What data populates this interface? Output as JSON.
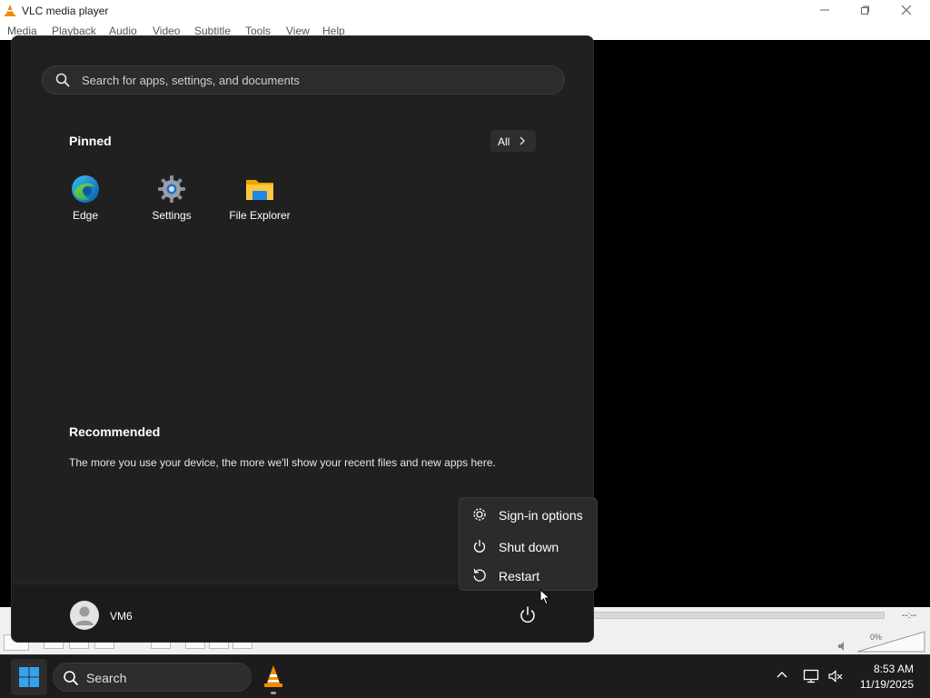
{
  "vlc": {
    "title": "VLC media player",
    "menu": [
      "Media",
      "Playback",
      "Audio",
      "Video",
      "Subtitle",
      "Tools",
      "View",
      "Help"
    ],
    "time_remaining": "--:--",
    "volume": "0%"
  },
  "start_menu": {
    "search_placeholder": "Search for apps, settings, and documents",
    "pinned_heading": "Pinned",
    "all_label": "All",
    "pinned_apps": [
      {
        "name": "Edge",
        "icon": "edge-icon"
      },
      {
        "name": "Settings",
        "icon": "gear-icon"
      },
      {
        "name": "File Explorer",
        "icon": "folder-icon"
      }
    ],
    "recommended_heading": "Recommended",
    "recommended_text": "The more you use your device, the more we'll show your recent files and new apps here.",
    "user_name": "VM6"
  },
  "power_menu": {
    "items": [
      {
        "label": "Sign-in options",
        "icon": "gear-icon"
      },
      {
        "label": "Shut down",
        "icon": "power-icon"
      },
      {
        "label": "Restart",
        "icon": "restart-icon"
      }
    ]
  },
  "taskbar": {
    "search_placeholder": "Search",
    "time": "8:53 AM",
    "date": "11/19/2025"
  },
  "colors": {
    "start_bg": "#202020",
    "taskbar_bg": "#1c1c1c",
    "vlc_orange": "#f28c00",
    "windows_blue": "#33a3f0"
  }
}
